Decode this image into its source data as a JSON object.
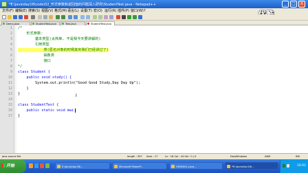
{
  "window": {
    "title": "*E:\\java\\day18\\code\\02_形式参数和返回值的问题深入研究\\StudentTest.java - Notepad++",
    "min_glyph": "_",
    "max_glyph": "□",
    "close_glyph": "X"
  },
  "menu": [
    "文件(F)",
    "编辑(E)",
    "搜索(S)",
    "视图(V)",
    "格式(M)",
    "语言(L)",
    "设置(T)",
    "宏(O)",
    "运行(R)",
    "插件(P)",
    "窗口(W)",
    "?"
  ],
  "watermark": "优酷",
  "tabs": [
    {
      "label": "Demo.java"
    },
    {
      "label": "StudentTest.java"
    },
    {
      "label": "Test.java"
    },
    {
      "label": "StudentTest.java"
    }
  ],
  "editor": {
    "line_numbers": [
      "1",
      "2",
      "3",
      "4",
      "5",
      "6",
      "7",
      "8",
      "9",
      "10",
      "11",
      "12",
      "13",
      "14",
      "15",
      "16",
      "17"
    ],
    "lines": [
      {
        "t": "/*"
      },
      {
        "t": "    形式参数:"
      },
      {
        "t": "        基本类型(太简单, 不是我今天要讲解的)"
      },
      {
        "t": "        引用类型"
      },
      {
        "t": "            类(匿名对象的时候其实我们已经讲过了)"
      },
      {
        "t": "            抽象类"
      },
      {
        "t": "            接口"
      },
      {
        "t": "*/"
      },
      {
        "t": "class Student {"
      },
      {
        "t": "    public void study() {"
      },
      {
        "t": "        System.out.println(\"Good Good Study,Day Day Up\");"
      },
      {
        "t": "    }"
      },
      {
        "t": "}"
      },
      {
        "t": ""
      },
      {
        "t": "class StudentTest {"
      },
      {
        "t": "    public static void mai"
      },
      {
        "t": "}"
      }
    ]
  },
  "status": {
    "filetype": "Java source file",
    "length": "length : 357",
    "lines": "lines : 17",
    "position": "Ln : 16   Col : 24   Sel : 0 | 0",
    "eol": "Dos\\Windows",
    "encoding": "ANSI",
    "mode": "INS"
  },
  "taskbar": {
    "start_label": "开始",
    "tasks": [
      {
        "label": "E:\\java\\day18\\..."
      },
      {
        "label": "Microsoft PowerP..."
      },
      {
        "label": "HSDB\\01-java..."
      },
      {
        "label": "*E:\\java\\day18\\..."
      }
    ],
    "clock": "16:02"
  }
}
